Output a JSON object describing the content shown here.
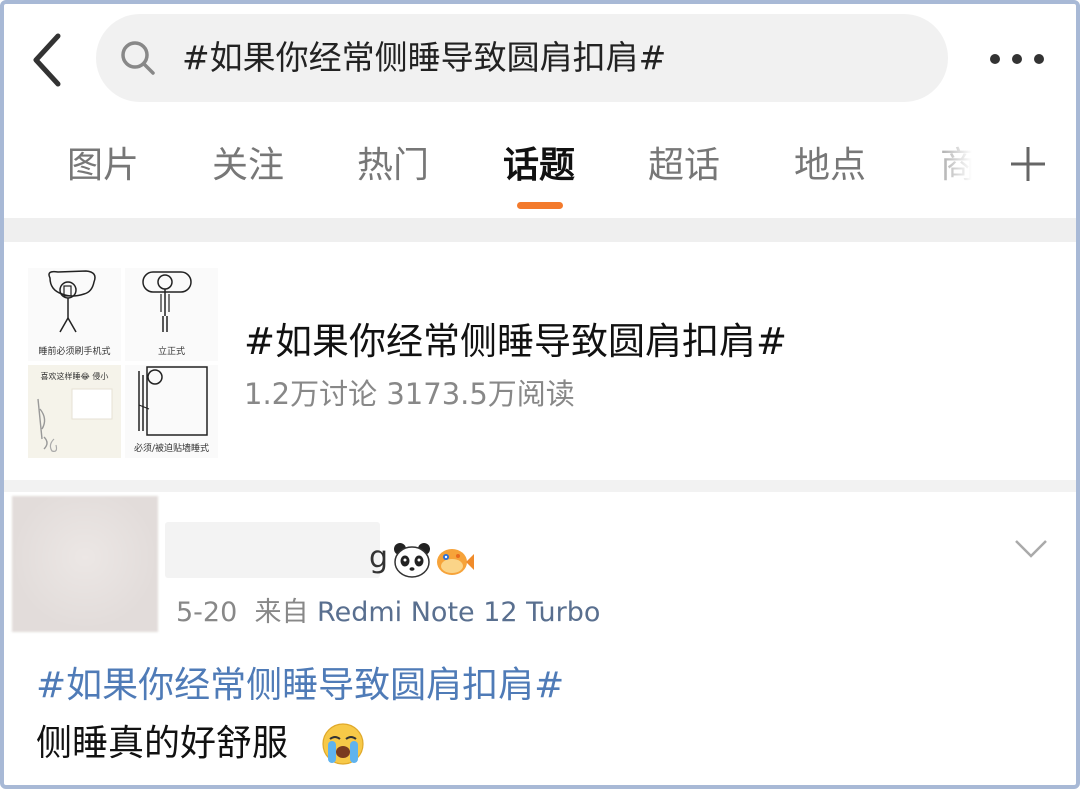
{
  "search": {
    "query": "#如果你经常侧睡导致圆肩扣肩#"
  },
  "tabs": [
    {
      "label": "图片"
    },
    {
      "label": "关注"
    },
    {
      "label": "热门"
    },
    {
      "label": "话题",
      "active": true
    },
    {
      "label": "超话"
    },
    {
      "label": "地点"
    },
    {
      "label": "商"
    }
  ],
  "topic": {
    "title": "#如果你经常侧睡导致圆肩扣肩#",
    "stats": "1.2万讨论 3173.5万阅读",
    "thumbnail_captions": [
      "睡前必须刷手机式",
      "立正式",
      "必须/被迫贴墙睡式",
      "喜欢这样睡😂 侵小"
    ]
  },
  "post": {
    "username_tail": "g",
    "date": "5-20",
    "source_prefix": "来自",
    "source": "Redmi Note 12 Turbo",
    "hashtag": "#如果你经常侧睡导致圆肩扣肩#",
    "text": "侧睡真的好舒服"
  },
  "icons": [
    "back-icon",
    "search-icon",
    "more-icon",
    "add-tab-icon",
    "chevron-down-icon",
    "panda-emoji-icon",
    "pufferfish-emoji-icon",
    "crying-emoji-icon"
  ],
  "colors": {
    "accent": "#f37a2c",
    "link": "#4f7bb7",
    "source": "#596f8f",
    "muted": "#888888",
    "frame": "#a8b9d6"
  }
}
